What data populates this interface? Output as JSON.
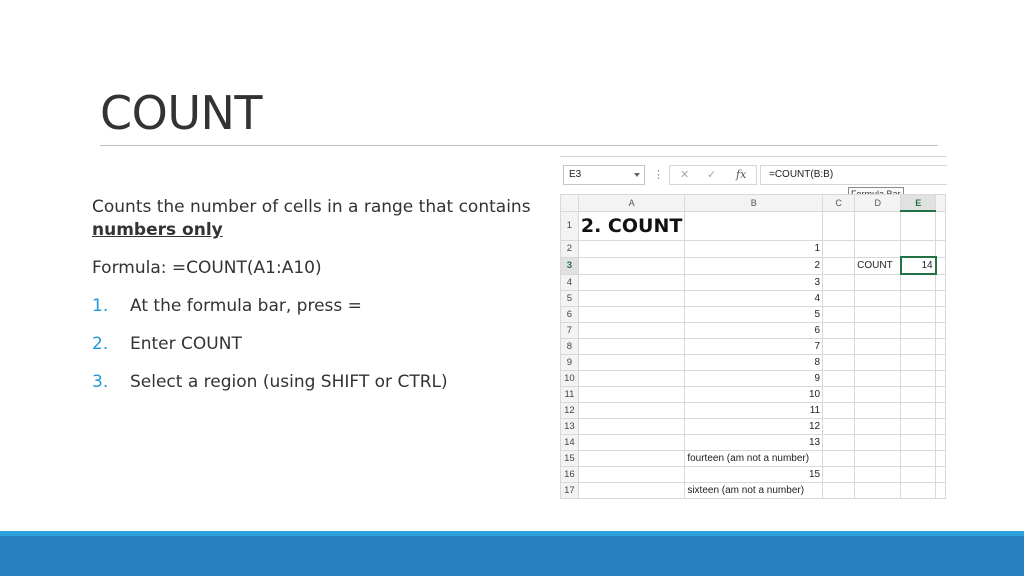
{
  "slide": {
    "title": "COUNT",
    "description_prefix": "Counts the number of cells in a range that contains",
    "description_emphasis": "numbers only",
    "formula_line": "Formula: =COUNT(A1:A10)",
    "steps": [
      {
        "num": "1.",
        "text": "At the formula bar, press ="
      },
      {
        "num": "2.",
        "text": "Enter COUNT"
      },
      {
        "num": "3.",
        "text": "Select a region (using SHIFT or CTRL)"
      }
    ]
  },
  "spreadsheet": {
    "name_box": "E3",
    "formula": "=COUNT(B:B)",
    "fx_label": "fx",
    "tooltip": "Formula Bar",
    "columns": [
      "A",
      "B",
      "C",
      "D",
      "E"
    ],
    "selected_column": "E",
    "selected_row": "3",
    "rows": [
      {
        "n": "1",
        "a": "2. COUNT",
        "b": "",
        "c": "",
        "d": "",
        "e": ""
      },
      {
        "n": "2",
        "a": "",
        "b": "1",
        "c": "",
        "d": "",
        "e": ""
      },
      {
        "n": "3",
        "a": "",
        "b": "2",
        "c": "",
        "d": "COUNT",
        "e": "14"
      },
      {
        "n": "4",
        "a": "",
        "b": "3",
        "c": "",
        "d": "",
        "e": ""
      },
      {
        "n": "5",
        "a": "",
        "b": "4",
        "c": "",
        "d": "",
        "e": ""
      },
      {
        "n": "6",
        "a": "",
        "b": "5",
        "c": "",
        "d": "",
        "e": ""
      },
      {
        "n": "7",
        "a": "",
        "b": "6",
        "c": "",
        "d": "",
        "e": ""
      },
      {
        "n": "8",
        "a": "",
        "b": "7",
        "c": "",
        "d": "",
        "e": ""
      },
      {
        "n": "9",
        "a": "",
        "b": "8",
        "c": "",
        "d": "",
        "e": ""
      },
      {
        "n": "10",
        "a": "",
        "b": "9",
        "c": "",
        "d": "",
        "e": ""
      },
      {
        "n": "11",
        "a": "",
        "b": "10",
        "c": "",
        "d": "",
        "e": ""
      },
      {
        "n": "12",
        "a": "",
        "b": "11",
        "c": "",
        "d": "",
        "e": ""
      },
      {
        "n": "13",
        "a": "",
        "b": "12",
        "c": "",
        "d": "",
        "e": ""
      },
      {
        "n": "14",
        "a": "",
        "b": "13",
        "c": "",
        "d": "",
        "e": ""
      },
      {
        "n": "15",
        "a": "",
        "b": "fourteen (am not a number)",
        "c": "",
        "d": "",
        "e": ""
      },
      {
        "n": "16",
        "a": "",
        "b": "15",
        "c": "",
        "d": "",
        "e": ""
      },
      {
        "n": "17",
        "a": "",
        "b": "sixteen (am not a number)",
        "c": "",
        "d": "",
        "e": ""
      }
    ]
  },
  "colors": {
    "accent": "#1e9ad6",
    "footer": "#2a7fc0",
    "excel_green": "#217346"
  }
}
